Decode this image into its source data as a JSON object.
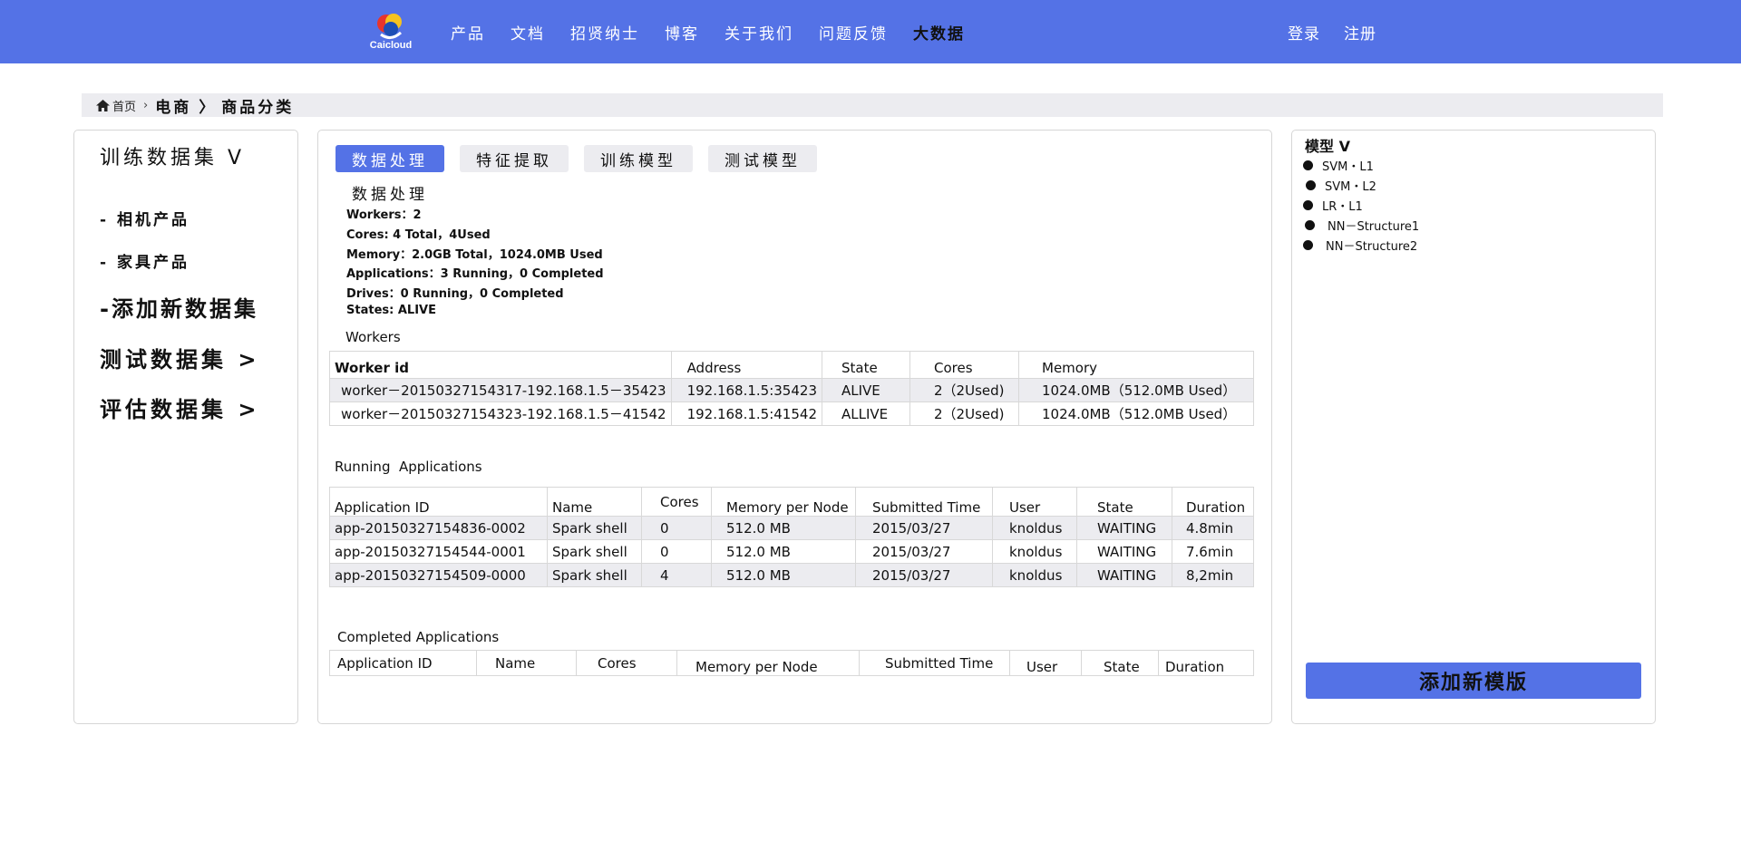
{
  "header": {
    "logo_text": "Caicloud",
    "nav": [
      "产品",
      "文档",
      "招贤纳士",
      "博客",
      "关于我们",
      "问题反馈",
      "大数据"
    ],
    "auth": [
      "登录",
      "注册"
    ]
  },
  "breadcrumb": {
    "home": "首页",
    "level1": "电商",
    "level2": "商品分类"
  },
  "sidebar": {
    "train_title": "训练数据集 V",
    "items": [
      "- 相机产品",
      "- 家具产品",
      "-添加新数据集"
    ],
    "test_title": "测试数据集 >",
    "eval_title": "评估数据集 >"
  },
  "tabs": [
    "数据处理",
    "特征提取",
    "训练模型",
    "测试模型"
  ],
  "summary": {
    "title": "数据处理",
    "workers": "Workers：2",
    "cores": "Cores: 4 Total，4Used",
    "memory": "Memory：2.0GB Total，1024.0MB Used",
    "applications": "Applications：3 Running，0 Completed",
    "drives": "Drives：0 Running，0 Completed",
    "states": "States: ALIVE"
  },
  "workers": {
    "title": "Workers",
    "columns": [
      "Worker id",
      "Address",
      "State",
      "Cores",
      "Memory"
    ],
    "rows": [
      [
        "worker－20150327154317-192.168.1.5－35423",
        "192.168.1.5:35423",
        "ALIVE",
        "2（2Used)",
        "1024.0MB（512.0MB Used）"
      ],
      [
        "worker－20150327154323-192.168.1.5－41542",
        "192.168.1.5:41542",
        "ALLIVE",
        "2（2Used)",
        "1024.0MB（512.0MB Used）"
      ]
    ]
  },
  "running": {
    "title": "Running  Applications",
    "columns": [
      "Application ID",
      "Name",
      "Cores",
      "Memory per Node",
      "Submitted Time",
      "User",
      "State",
      "Duration"
    ],
    "rows": [
      [
        "app-20150327154836-0002",
        "Spark shell",
        "0",
        "512.0 MB",
        "2015/03/27",
        "knoldus",
        "WAITING",
        "4.8min"
      ],
      [
        "app-20150327154544-0001",
        "Spark shell",
        "0",
        "512.0 MB",
        "2015/03/27",
        "knoldus",
        "WAITING",
        "7.6min"
      ],
      [
        "app-20150327154509-0000",
        "Spark shell",
        "4",
        "512.0 MB",
        "2015/03/27",
        "knoldus",
        "WAITING",
        "8,2min"
      ]
    ]
  },
  "completed": {
    "title": "Completed Applications",
    "columns": [
      "Application ID",
      "Name",
      "Cores",
      "Memory per Node",
      "Submitted Time",
      "User",
      "State",
      "Duration"
    ]
  },
  "models": {
    "title": "模型 V",
    "items": [
      "SVM・L1",
      "SVM・L2",
      "LR・L1",
      "NN－Structure1",
      "NN－Structure2"
    ],
    "add_button": "添加新模版"
  },
  "colors": {
    "accent": "#5472e6",
    "muted_bg": "#ececf0"
  }
}
